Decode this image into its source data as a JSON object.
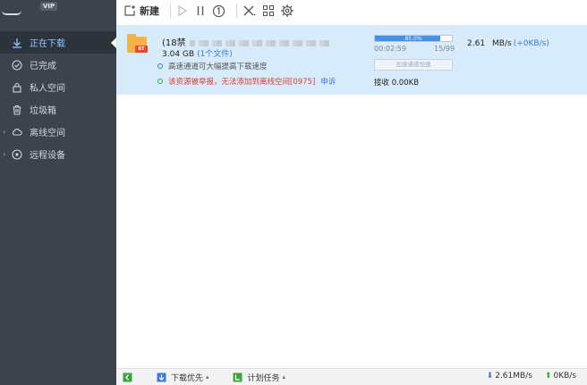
{
  "brand": {
    "vip_badge": "VIP"
  },
  "sidebar": {
    "items": [
      {
        "label": "正在下载",
        "icon": "download-arrow-icon",
        "active": true
      },
      {
        "label": "已完成",
        "icon": "check-circle-icon"
      },
      {
        "label": "私人空间",
        "icon": "lock-icon"
      },
      {
        "label": "垃圾箱",
        "icon": "trash-icon"
      },
      {
        "label": "离线空间",
        "icon": "cloud-icon",
        "expandable": true
      },
      {
        "label": "远程设备",
        "icon": "remote-device-icon",
        "expandable": true
      }
    ]
  },
  "toolbar": {
    "new_label": "新建",
    "icons": [
      "new-file-icon",
      "play-icon",
      "pause-icon",
      "limit-speed-icon",
      "delete-icon",
      "grid-apps-icon",
      "settings-gear-icon"
    ]
  },
  "task": {
    "name_prefix": "(18禁",
    "size": "3.04 GB",
    "files": "(1个文件)",
    "tag": "BT",
    "hint": "高速通道可大幅提高下载速度",
    "warning": "该资源被举报，无法添加到离线空间[0975]",
    "warning_link": "申诉",
    "progress_percent": 85.0,
    "progress_label": "85.0%",
    "elapsed": "00:02:59",
    "peers": "15/99",
    "accelerate_label": "加速通道加速",
    "received": "接收 0.00KB",
    "speed": "2.61",
    "speed_unit": "MB/s",
    "speed_extra": "(+0KB/s)"
  },
  "statusbar": {
    "download_priority": "下载优先",
    "scheduled_tasks": "计划任务",
    "down_speed": "2.61MB/s",
    "up_speed": "0KB/s"
  },
  "colors": {
    "sidebar_bg": "#3c434d",
    "active_bg": "#2d333b",
    "active_text": "#8fc6ff",
    "row_selected": "#d7ebfb",
    "progress": "#4a90e2",
    "warning": "#e23b2e",
    "link": "#3a7bd5"
  }
}
